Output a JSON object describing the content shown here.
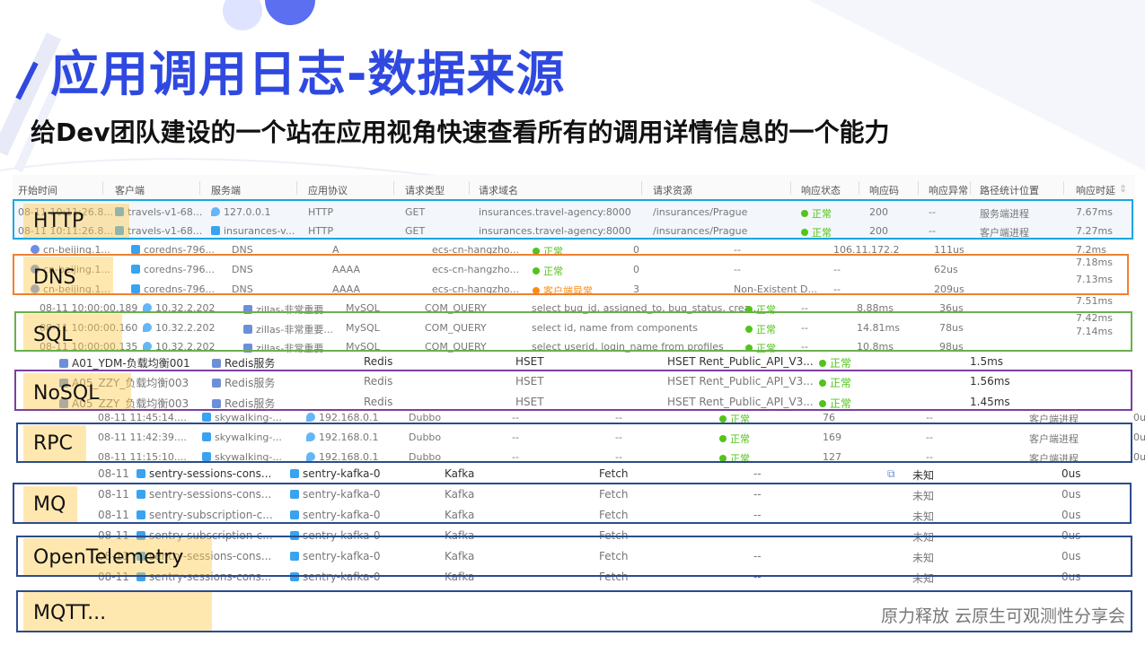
{
  "title": "应用调用日志-数据来源",
  "subtitle": "给Dev团队建设的一个站在应用视角快速查看所有的调用详情信息的一个能力",
  "footer": "原力释放  云原生可观测性分享会",
  "categories": [
    {
      "label": "HTTP",
      "color": "#1aa7df"
    },
    {
      "label": "DNS",
      "color": "#f08030"
    },
    {
      "label": "SQL",
      "color": "#6ab04c"
    },
    {
      "label": "NoSQL",
      "color": "#7b3fa0"
    },
    {
      "label": "RPC",
      "color": "#2b4c8c"
    },
    {
      "label": "MQ",
      "color": "#2b4c8c"
    },
    {
      "label": "OpenTelemetry",
      "color": "#2b4c8c"
    },
    {
      "label": "MQTT...",
      "color": "#2b4c8c"
    }
  ],
  "header": [
    "开始时间",
    "客户端",
    "服务端",
    "应用协议",
    "请求类型",
    "请求域名",
    "请求资源",
    "响应状态",
    "响应码",
    "响应异常",
    "路径统计位置",
    "响应时延"
  ],
  "rows": {
    "http": [
      [
        "08-11 10:11:26.8...",
        "travels-v1-68...",
        "127.0.0.1",
        "HTTP",
        "GET",
        "insurances.travel-agency:8000",
        "/insurances/Prague",
        "正常",
        "200",
        "--",
        "服务端进程",
        "7.67ms"
      ],
      [
        "08-11 10:11:26.8...",
        "travels-v1-68...",
        "insurances-v...",
        "HTTP",
        "GET",
        "insurances.travel-agency:8000",
        "/insurances/Prague",
        "正常",
        "200",
        "--",
        "客户端进程",
        "7.27ms"
      ]
    ],
    "dns": [
      [
        "cn-beijing.1...",
        "coredns-796...",
        "DNS",
        "A",
        "ecs-cn-hangzho...",
        "正常",
        "0",
        "--",
        "106.11.172.2",
        "111us",
        "7.2ms"
      ],
      [
        "cn-beijing.1...",
        "coredns-796...",
        "DNS",
        "AAAA",
        "ecs-cn-hangzho...",
        "正常",
        "0",
        "--",
        "--",
        "62us",
        "7.18ms"
      ],
      [
        "cn-beijing.1...",
        "coredns-796...",
        "DNS",
        "AAAA",
        "ecs-cn-hangzho...",
        "客户端异常",
        "3",
        "Non-Existent D...",
        "--",
        "209us",
        "7.13ms"
      ]
    ],
    "sql": [
      [
        "08-11 10:00:00.189",
        "10.32.2.202",
        "zillas-非常重要...",
        "MySQL",
        "COM_QUERY",
        "select bug_id, assigned_to, bug_status, crea...",
        "正常",
        "--",
        "8.88ms",
        "36us",
        "7.51ms"
      ],
      [
        "08-11 10:00:00.160",
        "10.32.2.202",
        "zillas-非常重要...",
        "MySQL",
        "COM_QUERY",
        "select id, name from components",
        "正常",
        "--",
        "14.81ms",
        "78us",
        "7.42ms"
      ],
      [
        "08-11 10:00:00.135",
        "10.32.2.202",
        "zillas-非常重要...",
        "MySQL",
        "COM_QUERY",
        "select userid, login_name from profiles",
        "正常",
        "--",
        "10.8ms",
        "98us",
        "7.14ms"
      ]
    ],
    "nosql": [
      [
        "A01_YDM-负载均衡001",
        "Redis服务",
        "Redis",
        "HSET",
        "HSET Rent_Public_API_V3...",
        "正常",
        "1.5ms"
      ],
      [
        "A05_ZZY_负载均衡003",
        "Redis服务",
        "Redis",
        "HSET",
        "HSET Rent_Public_API_V3...",
        "正常",
        "1.56ms"
      ],
      [
        "A05_ZZY_负载均衡003",
        "Redis服务",
        "Redis",
        "HSET",
        "HSET Rent_Public_API_V3...",
        "正常",
        "1.45ms"
      ]
    ],
    "rpc": [
      [
        "08-11 11:45:14....",
        "skywalking-...",
        "192.168.0.1",
        "Dubbo",
        "--",
        "--",
        "正常",
        "76",
        "--",
        "客户端进程",
        "0u"
      ],
      [
        "08-11 11:42:39....",
        "skywalking-...",
        "192.168.0.1",
        "Dubbo",
        "--",
        "--",
        "正常",
        "169",
        "--",
        "客户端进程",
        "0u"
      ],
      [
        "08-11 11:15:10....",
        "skywalking-...",
        "192.168.0.1",
        "Dubbo",
        "--",
        "--",
        "正常",
        "127",
        "--",
        "客户端进程",
        "0u"
      ]
    ],
    "mq": [
      [
        "08-11",
        "sentry-sessions-cons...",
        "sentry-kafka-0",
        "Kafka",
        "Fetch",
        "--",
        "未知",
        "0us"
      ],
      [
        "08-11",
        "sentry-sessions-cons...",
        "sentry-kafka-0",
        "Kafka",
        "Fetch",
        "--",
        "未知",
        "0us"
      ],
      [
        "08-11",
        "sentry-subscription-c...",
        "sentry-kafka-0",
        "Kafka",
        "Fetch",
        "--",
        "未知",
        "0us"
      ],
      [
        "08-11",
        "sentry-subscription-c...",
        "sentry-kafka-0",
        "Kafka",
        "Fetch",
        "--",
        "未知",
        "0us"
      ],
      [
        "08-11",
        "sentry-sessions-cons...",
        "sentry-kafka-0",
        "Kafka",
        "Fetch",
        "--",
        "未知",
        "0us"
      ],
      [
        "08-11",
        "sentry-sessions-cons...",
        "sentry-kafka-0",
        "Kafka",
        "Fetch",
        "--",
        "未知",
        "0us"
      ]
    ]
  },
  "colors": {
    "accent": "#2f49e0",
    "ok": "#52c41a",
    "warn": "#fa8c16"
  }
}
